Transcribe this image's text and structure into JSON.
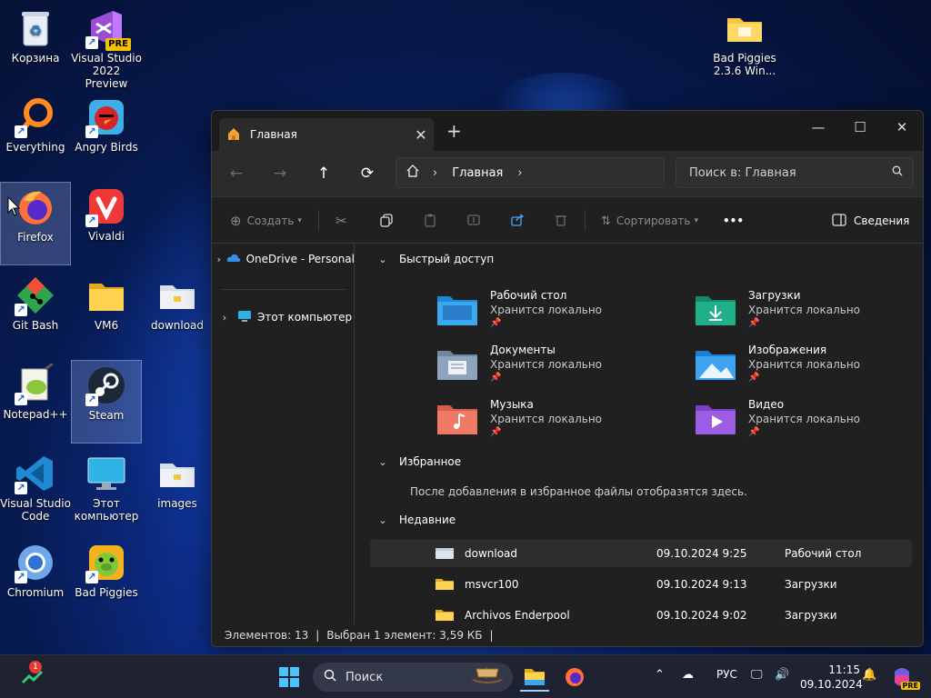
{
  "desktop": {
    "icons": [
      {
        "label": "Корзина"
      },
      {
        "label": "Visual Studio 2022 Preview"
      },
      {
        "label": "Bad Piggies 2.3.6 Win..."
      },
      {
        "label": "Everything"
      },
      {
        "label": "Angry Birds"
      },
      {
        "label": "Firefox"
      },
      {
        "label": "Vivaldi"
      },
      {
        "label": "Git Bash"
      },
      {
        "label": "VM6"
      },
      {
        "label": "download"
      },
      {
        "label": "Notepad++"
      },
      {
        "label": "Steam"
      },
      {
        "label": "Visual Studio Code"
      },
      {
        "label": "Этот компьютер"
      },
      {
        "label": "images"
      },
      {
        "label": "Chromium"
      },
      {
        "label": "Bad Piggies"
      }
    ],
    "badge_pre": "PRE"
  },
  "explorer": {
    "tab_title": "Главная",
    "breadcrumb": "Главная",
    "search_placeholder": "Поиск в: Главная",
    "toolbar": {
      "create": "Создать",
      "sort": "Сортировать",
      "more": "•••",
      "details": "Сведения"
    },
    "nav": [
      {
        "label": "OneDrive - Personal"
      },
      {
        "label": "Этот компьютер"
      }
    ],
    "quick_access": {
      "title": "Быстрый доступ",
      "items": [
        {
          "name": "Рабочий стол",
          "sub": "Хранится локально"
        },
        {
          "name": "Загрузки",
          "sub": "Хранится локально"
        },
        {
          "name": "Документы",
          "sub": "Хранится локально"
        },
        {
          "name": "Изображения",
          "sub": "Хранится локально"
        },
        {
          "name": "Музыка",
          "sub": "Хранится локально"
        },
        {
          "name": "Видео",
          "sub": "Хранится локально"
        }
      ]
    },
    "favorites": {
      "title": "Избранное",
      "hint": "После добавления в избранное файлы отобразятся здесь."
    },
    "recent": {
      "title": "Недавние",
      "rows": [
        {
          "name": "download",
          "date": "09.10.2024 9:25",
          "location": "Рабочий стол"
        },
        {
          "name": "msvcr100",
          "date": "09.10.2024 9:13",
          "location": "Загрузки"
        },
        {
          "name": "Archivos Enderpool",
          "date": "09.10.2024 9:02",
          "location": "Загрузки"
        }
      ]
    },
    "status": {
      "items": "Элементов: 13",
      "selected": "Выбран 1 элемент: 3,59 КБ"
    }
  },
  "taskbar": {
    "notification_count": "1",
    "search_label": "Поиск",
    "language": "РУС",
    "time": "11:15",
    "date": "09.10.2024",
    "copilot_badge": "PRE"
  }
}
